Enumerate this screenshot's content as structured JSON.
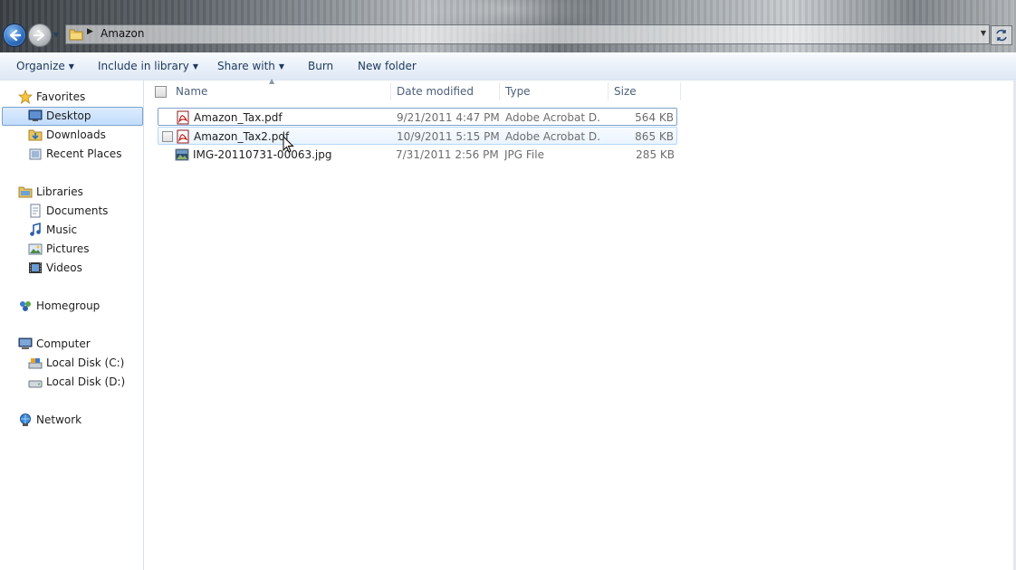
{
  "address": {
    "crumb": "Amazon"
  },
  "toolbar": {
    "organize": "Organize",
    "include_in_library": "Include in library",
    "share_with": "Share with",
    "burn": "Burn",
    "new_folder": "New folder"
  },
  "nav": {
    "favorites": "Favorites",
    "desktop": "Desktop",
    "downloads": "Downloads",
    "recent_places": "Recent Places",
    "libraries": "Libraries",
    "documents": "Documents",
    "music": "Music",
    "pictures": "Pictures",
    "videos": "Videos",
    "homegroup": "Homegroup",
    "computer": "Computer",
    "local_disk_c": "Local Disk (C:)",
    "local_disk_d": "Local Disk (D:)",
    "network": "Network",
    "selected": "Desktop"
  },
  "columns": {
    "name": "Name",
    "date_modified": "Date modified",
    "type": "Type",
    "size": "Size"
  },
  "files": [
    {
      "name": "Amazon_Tax.pdf",
      "date": "9/21/2011 4:47 PM",
      "type": "Adobe Acrobat D...",
      "size": "564 KB",
      "icon": "pdf-icon"
    },
    {
      "name": "Amazon_Tax2.pdf",
      "date": "10/9/2011 5:15 PM",
      "type": "Adobe Acrobat D...",
      "size": "865 KB",
      "icon": "pdf-icon"
    },
    {
      "name": "IMG-20110731-00063.jpg",
      "date": "7/31/2011 2:56 PM",
      "type": "JPG File",
      "size": "285 KB",
      "icon": "image-icon"
    }
  ],
  "colors": {
    "accent": "#1e395b",
    "selection_border": "#7da2ce",
    "muted_text": "#6d6d6d"
  }
}
